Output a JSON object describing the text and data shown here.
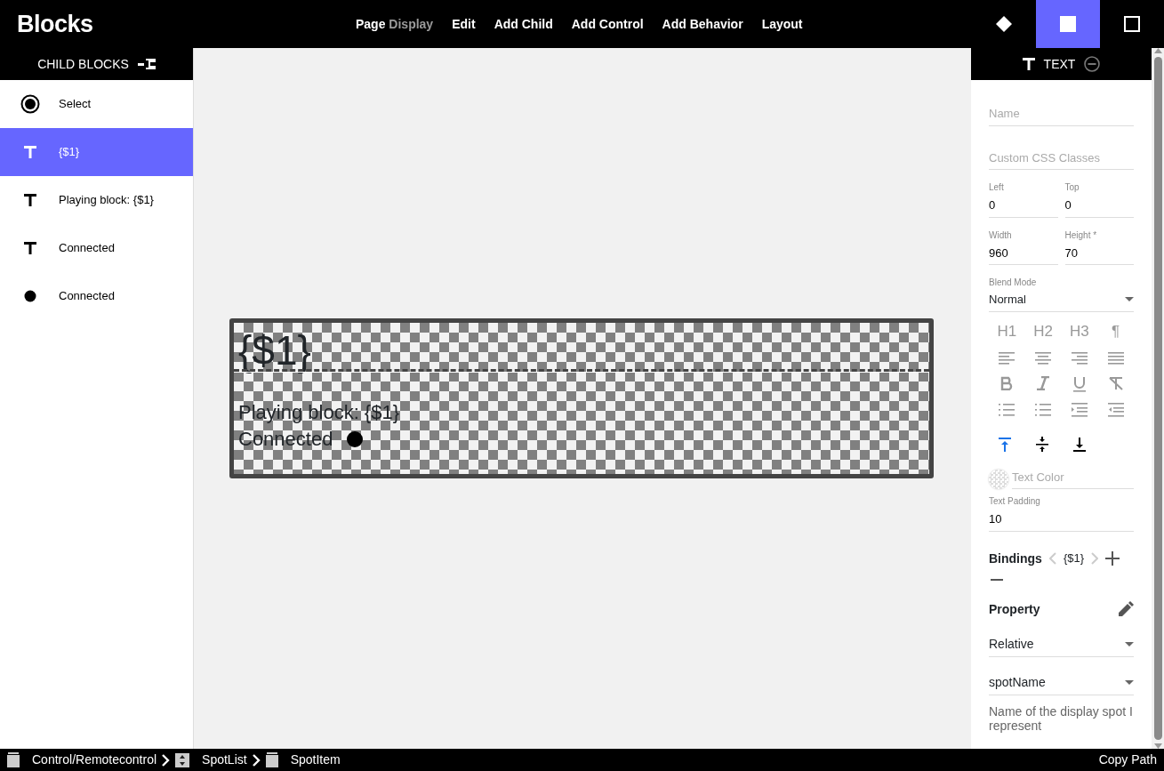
{
  "app": {
    "logo": "Blocks"
  },
  "menu": [
    {
      "label": "Page",
      "sublabel": "Display"
    },
    {
      "label": "Edit"
    },
    {
      "label": "Add Child"
    },
    {
      "label": "Add Control"
    },
    {
      "label": "Add Behavior"
    },
    {
      "label": "Layout"
    }
  ],
  "mode_buttons": [
    {
      "kind": "diamond",
      "selected": false
    },
    {
      "kind": "filled-square",
      "selected": true
    },
    {
      "kind": "outline-square",
      "selected": false
    }
  ],
  "sidebar": {
    "title": "CHILD BLOCKS",
    "items": [
      {
        "kind": "select",
        "label": "Select",
        "selected": false
      },
      {
        "kind": "text",
        "label": "{$1}",
        "selected": true
      },
      {
        "kind": "text",
        "label": "Playing block: {$1}",
        "selected": false
      },
      {
        "kind": "text",
        "label": "Connected",
        "selected": false
      },
      {
        "kind": "dot",
        "label": "Connected",
        "selected": false
      }
    ]
  },
  "canvas": {
    "heading": "{$1}",
    "lines": [
      "Playing block: {$1}",
      "Connected"
    ]
  },
  "properties": {
    "title": "TEXT",
    "text_fields": [
      {
        "placeholder": "Name"
      },
      {
        "placeholder": "Custom CSS Classes"
      }
    ],
    "pairs": [
      [
        {
          "label": "Left",
          "value": "0"
        },
        {
          "label": "Top",
          "value": "0"
        }
      ],
      [
        {
          "label": "Width",
          "value": "960"
        },
        {
          "label": "Height *",
          "value": "70"
        }
      ]
    ],
    "blend_mode": {
      "label": "Blend Mode",
      "value": "Normal"
    },
    "heading_buttons": [
      "H1",
      "H2",
      "H3",
      "¶"
    ],
    "vertical_align": [
      {
        "kind": "top",
        "selected": true
      },
      {
        "kind": "middle",
        "selected": false
      },
      {
        "kind": "bottom",
        "selected": false
      }
    ],
    "text_color": {
      "placeholder": "Text Color"
    },
    "text_padding": {
      "label": "Text Padding",
      "value": "10"
    },
    "bindings": {
      "label": "Bindings",
      "value": "{$1}"
    },
    "property": {
      "label": "Property",
      "mode": "Relative",
      "name": "spotName",
      "description": "Name of the display spot I represent"
    }
  },
  "status_bar": {
    "path": [
      {
        "kind": "stack",
        "label": "Control/Remotecontrol"
      },
      {
        "kind": "list",
        "label": "SpotList"
      },
      {
        "kind": "stack",
        "label": "SpotItem"
      }
    ],
    "action": "Copy Path"
  }
}
